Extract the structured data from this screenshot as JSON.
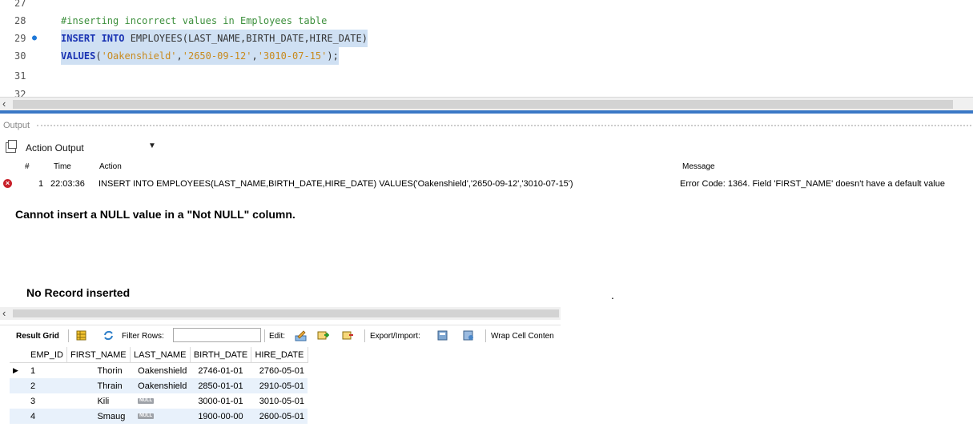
{
  "editor": {
    "lines": [
      {
        "num": "27",
        "text": ""
      },
      {
        "num": "28",
        "comment": "#inserting incorrect values in Employees table"
      },
      {
        "num": "29",
        "marker": true,
        "kw": "INSERT INTO",
        "rest": " EMPLOYEES(LAST_NAME,BIRTH_DATE,HIRE_DATE)"
      },
      {
        "num": "30",
        "kw": "VALUES",
        "p1": "(",
        "s1": "'Oakenshield'",
        "c1": ",",
        "s2": "'2650-09-12'",
        "c2": ",",
        "s3": "'3010-07-15'",
        "end": ");"
      },
      {
        "num": "31",
        "text": ""
      },
      {
        "num": "32",
        "text": ""
      }
    ]
  },
  "output": {
    "title": "Output",
    "dropdown_label": "Action Output",
    "columns": {
      "num": "#",
      "time": "Time",
      "action": "Action",
      "message": "Message"
    },
    "row": {
      "num": "1",
      "time": "22:03:36",
      "action": "INSERT INTO EMPLOYEES(LAST_NAME,BIRTH_DATE,HIRE_DATE) VALUES('Oakenshield','2650-09-12','3010-07-15')",
      "message": "Error Code: 1364. Field 'FIRST_NAME' doesn't have a default value",
      "status": "error"
    }
  },
  "notes": {
    "null_note": "Cannot insert a NULL value in a \"Not NULL\" column.",
    "no_record": "No Record inserted",
    "dot": "."
  },
  "grid_toolbar": {
    "result_grid": "Result Grid",
    "filter_rows": "Filter Rows:",
    "edit": "Edit:",
    "export_import": "Export/Import:",
    "wrap_cell": "Wrap Cell Conten"
  },
  "grid": {
    "columns": [
      "EMP_ID",
      "FIRST_NAME",
      "LAST_NAME",
      "BIRTH_DATE",
      "HIRE_DATE"
    ],
    "rows": [
      {
        "emp_id": "1",
        "first_name": "Thorin",
        "last_name": "Oakenshield",
        "birth_date": "2746-01-01",
        "hire_date": "2760-05-01",
        "current": true
      },
      {
        "emp_id": "2",
        "first_name": "Thrain",
        "last_name": "Oakenshield",
        "birth_date": "2850-01-01",
        "hire_date": "2910-05-01"
      },
      {
        "emp_id": "3",
        "first_name": "Kili",
        "last_name": "NULL",
        "birth_date": "3000-01-01",
        "hire_date": "3010-05-01"
      },
      {
        "emp_id": "4",
        "first_name": "Smaug",
        "last_name": "NULL",
        "birth_date": "1900-00-00",
        "hire_date": "2600-05-01"
      }
    ],
    "null_label": "NULL"
  },
  "colors": {
    "selection": "#cfe0f3",
    "keyword": "#1a33b3",
    "string": "#c88a1e",
    "comment": "#3c8f3c",
    "splitter": "#3a78c6",
    "error": "#c8202a"
  }
}
